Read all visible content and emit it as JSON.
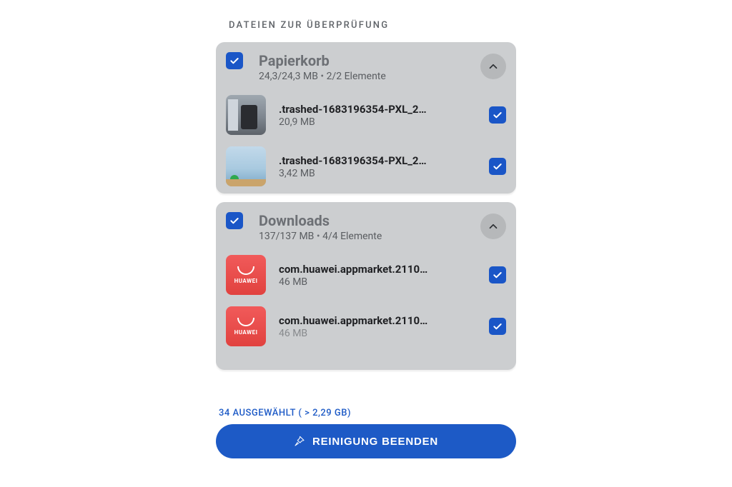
{
  "page": {
    "section_title": "DATEIEN ZUR ÜBERPRÜFUNG",
    "summary": "34 AUSGEWÄHLT ( > 2,29 GB)",
    "cta_label": "REINIGUNG BEENDEN"
  },
  "groups": [
    {
      "title": "Papierkorb",
      "size_text": "24,3/24,3 MB",
      "elements_text": "2/2 Elemente",
      "items": [
        {
          "name": ".trashed-1683196354-PXL_2…",
          "size": "20,9 MB"
        },
        {
          "name": ".trashed-1683196354-PXL_2…",
          "size": "3,42 MB"
        }
      ]
    },
    {
      "title": "Downloads",
      "size_text": "137/137 MB",
      "elements_text": "4/4 Elemente",
      "items": [
        {
          "name": "com.huawei.appmarket.2110…",
          "size": "46 MB"
        },
        {
          "name": "com.huawei.appmarket.2110…",
          "size": "46 MB"
        }
      ]
    }
  ]
}
